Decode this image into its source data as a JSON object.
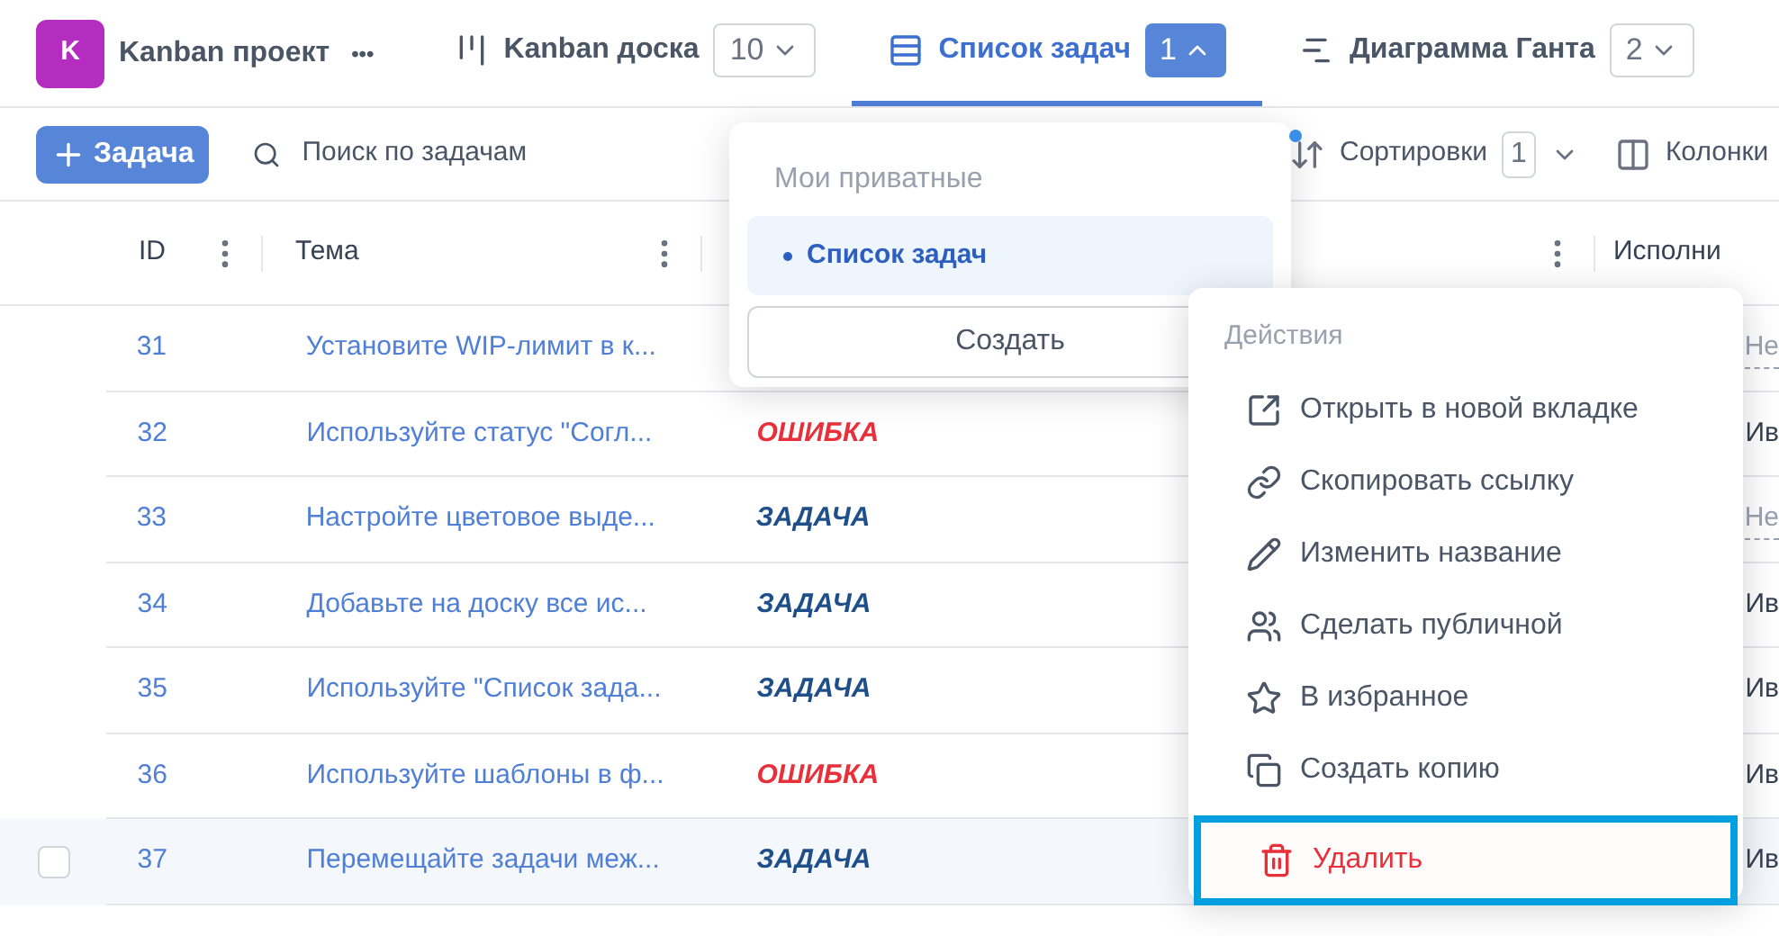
{
  "project": {
    "badge": "K",
    "name": "Kanban проект",
    "more": "•••"
  },
  "views": [
    {
      "kind": "board",
      "label": "Kanban доска",
      "count": "10",
      "selected": false
    },
    {
      "kind": "list",
      "label": "Список задач",
      "count": "1",
      "selected": true
    },
    {
      "kind": "gantt",
      "label": "Диаграмма Ганта",
      "count": "2",
      "selected": false
    }
  ],
  "toolbar": {
    "add_button": "Задача",
    "search": {
      "placeholder": "Поиск по задачам"
    },
    "sort": {
      "label": "Сортировки",
      "count": "1"
    },
    "columns": "Колонки"
  },
  "table": {
    "columns": [
      "ID",
      "Тема",
      "Исполни"
    ],
    "rows": [
      {
        "id": "31",
        "subject": "Установите WIP-лимит в к...",
        "assignee": {
          "name": "Не",
          "kind": "empty"
        },
        "selected": false
      },
      {
        "id": "32",
        "subject": "Используйте статус \"Согл...",
        "type": {
          "label": "ОШИБКА",
          "kind": "error"
        },
        "assignee": {
          "name": "Ив",
          "kind": "person"
        },
        "selected": false
      },
      {
        "id": "33",
        "subject": "Настройте цветовое выде...",
        "type": {
          "label": "ЗАДАЧА",
          "kind": "task"
        },
        "assignee": {
          "name": "Не",
          "kind": "empty"
        },
        "selected": false
      },
      {
        "id": "34",
        "subject": "Добавьте на доску все ис...",
        "type": {
          "label": "ЗАДАЧА",
          "kind": "task"
        },
        "assignee": {
          "name": "Ив",
          "kind": "person"
        },
        "selected": false
      },
      {
        "id": "35",
        "subject": "Используйте \"Список зада...",
        "type": {
          "label": "ЗАДАЧА",
          "kind": "task"
        },
        "assignee": {
          "name": "Ив",
          "kind": "person"
        },
        "selected": false
      },
      {
        "id": "36",
        "subject": "Используйте шаблоны в ф...",
        "type": {
          "label": "ОШИБКА",
          "kind": "error"
        },
        "assignee": {
          "name": "Ив",
          "kind": "person"
        },
        "selected": false
      },
      {
        "id": "37",
        "subject": "Перемещайте задачи меж...",
        "type": {
          "label": "ЗАДАЧА",
          "kind": "task"
        },
        "assignee": {
          "name": "Ив",
          "kind": "person"
        },
        "selected": true
      }
    ]
  },
  "views_menu": {
    "section": "Мои приватные",
    "items": [
      {
        "label": "Список задач",
        "selected": true
      }
    ],
    "create": "Создать"
  },
  "actions_menu": {
    "title": "Действия",
    "items": [
      {
        "kind": "open",
        "label": "Открыть в новой вкладке",
        "selected": false
      },
      {
        "kind": "link",
        "label": "Скопировать ссылку",
        "selected": false
      },
      {
        "kind": "rename",
        "label": "Изменить название",
        "selected": false
      },
      {
        "kind": "share",
        "label": "Сделать публичной",
        "selected": false
      },
      {
        "kind": "favorite",
        "label": "В избранное",
        "selected": false
      },
      {
        "kind": "copy",
        "label": "Создать копию",
        "selected": false
      },
      {
        "kind": "delete",
        "label": "Удалить",
        "selected": true
      }
    ]
  }
}
